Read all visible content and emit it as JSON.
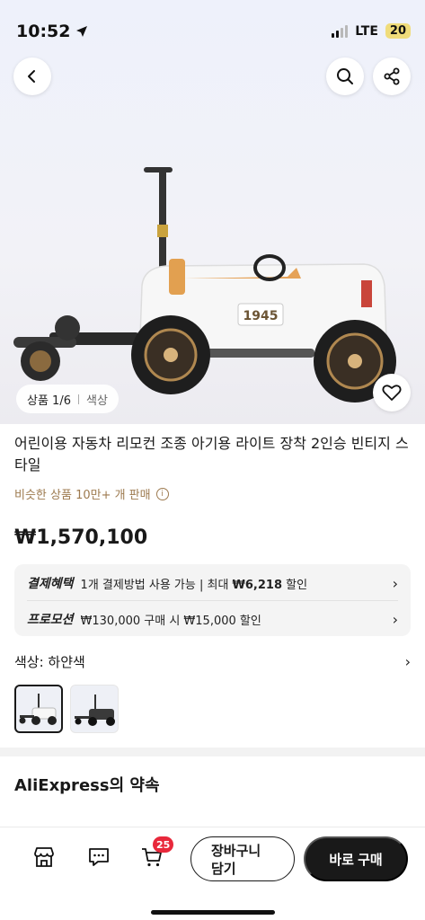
{
  "status_bar": {
    "time": "10:52",
    "network": "LTE",
    "battery": "20"
  },
  "gallery": {
    "counter": "상품 1/6",
    "tag": "색상",
    "car_plate": "1945"
  },
  "product": {
    "title": "어린이용 자동차 리모컨 조종 아기용 라이트 장착 2인승 빈티지 스타일",
    "sold_text": "비슷한 상품 10만+ 개 판매",
    "price": "₩1,570,100"
  },
  "benefits": {
    "payment_label": "결제혜택",
    "payment_count": "1",
    "payment_text_a": "개 결제방법 사용 가능 | 최대 ",
    "payment_amount": "₩6,218",
    "payment_text_b": " 할인",
    "promo_label": "프로모션",
    "promo_text": "₩130,000 구매 시 ₩15,000 할인"
  },
  "color_option": {
    "label": "색상: 하얀색"
  },
  "section": {
    "promise_title": "AliExpress의 약속"
  },
  "bottom_bar": {
    "cart_badge": "25",
    "add_to_cart": "장바구니\n담기",
    "buy_now": "바로 구매"
  },
  "colors": {
    "accent_brown": "#9d7a4f",
    "badge_red": "#e8283b",
    "dark": "#191919"
  }
}
